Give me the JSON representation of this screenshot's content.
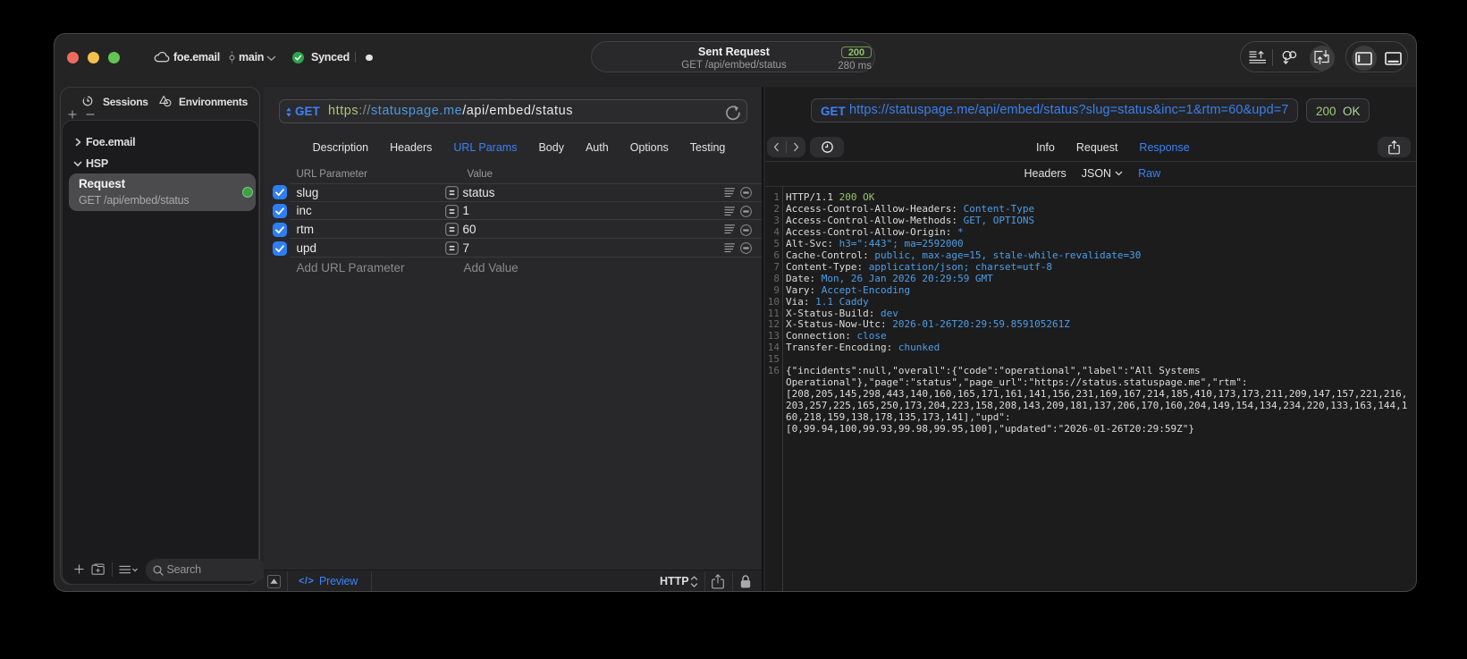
{
  "titlebar": {
    "project": "foe.email",
    "branch": "main",
    "sync_status": "Synced",
    "request_summary": {
      "title": "Sent Request",
      "subtitle": "GET /api/embed/status",
      "status_code": "200",
      "duration": "280 ms"
    }
  },
  "sidebar": {
    "tabs": [
      {
        "label": "Sessions",
        "icon": "history-clock-icon"
      },
      {
        "label": "Environments",
        "icon": "shapes-icon"
      }
    ],
    "tree": {
      "group_collapsed": "Foe.email",
      "group_expanded": "HSP",
      "selected_request": {
        "title": "Request",
        "subtitle": "GET /api/embed/status"
      }
    },
    "search_placeholder": "Search"
  },
  "request_editor": {
    "method": "GET",
    "url": {
      "scheme": "https",
      "sep": "://",
      "host": "statuspage.me",
      "path": "/api/embed/status"
    },
    "tabs": [
      "Description",
      "Headers",
      "URL Params",
      "Body",
      "Auth",
      "Options",
      "Testing"
    ],
    "active_tab": "URL Params",
    "params": {
      "col_name": "URL Parameter",
      "col_value": "Value",
      "rows": [
        {
          "name": "slug",
          "value": "status"
        },
        {
          "name": "inc",
          "value": "1"
        },
        {
          "name": "rtm",
          "value": "60"
        },
        {
          "name": "upd",
          "value": "7"
        }
      ],
      "add_name": "Add URL Parameter",
      "add_value": "Add Value"
    },
    "footer": {
      "code_glyph": "</>",
      "preview": "Preview",
      "protocol": "HTTP"
    }
  },
  "response_viewer": {
    "method": "GET",
    "url": "https://statuspage.me/api/embed/status?slug=status&inc=1&rtm=60&upd=7",
    "status_code": "200",
    "status_text": "OK",
    "tabs": [
      "Info",
      "Request",
      "Response"
    ],
    "active_tab": "Response",
    "subtabs": [
      "Headers",
      "JSON",
      "Raw"
    ],
    "active_subtab": "Raw",
    "lines": [
      {
        "n": "1",
        "parts": [
          {
            "t": "HTTP/1.1 ",
            "c": "rw"
          },
          {
            "t": "200 OK",
            "c": "rg"
          }
        ]
      },
      {
        "n": "2",
        "parts": [
          {
            "t": "Access-Control-Allow-Headers:",
            "c": "rn"
          },
          {
            "t": " Content-Type",
            "c": "rv"
          }
        ]
      },
      {
        "n": "3",
        "parts": [
          {
            "t": "Access-Control-Allow-Methods:",
            "c": "rn"
          },
          {
            "t": " GET, OPTIONS",
            "c": "rv"
          }
        ]
      },
      {
        "n": "4",
        "parts": [
          {
            "t": "Access-Control-Allow-Origin:",
            "c": "rn"
          },
          {
            "t": " *",
            "c": "rv"
          }
        ]
      },
      {
        "n": "5",
        "parts": [
          {
            "t": "Alt-Svc:",
            "c": "rn"
          },
          {
            "t": " h3=\":443\"; ma=2592000",
            "c": "rv"
          }
        ]
      },
      {
        "n": "6",
        "parts": [
          {
            "t": "Cache-Control:",
            "c": "rn"
          },
          {
            "t": " public, max-age=15, stale-while-revalidate=30",
            "c": "rv"
          }
        ]
      },
      {
        "n": "7",
        "parts": [
          {
            "t": "Content-Type:",
            "c": "rn"
          },
          {
            "t": " application/json; charset=utf-8",
            "c": "rv"
          }
        ]
      },
      {
        "n": "8",
        "parts": [
          {
            "t": "Date:",
            "c": "rn"
          },
          {
            "t": " Mon, 26 Jan 2026 20:29:59 GMT",
            "c": "rv"
          }
        ]
      },
      {
        "n": "9",
        "parts": [
          {
            "t": "Vary:",
            "c": "rn"
          },
          {
            "t": " Accept-Encoding",
            "c": "rv"
          }
        ]
      },
      {
        "n": "10",
        "parts": [
          {
            "t": "Via:",
            "c": "rn"
          },
          {
            "t": " 1.1 Caddy",
            "c": "rv"
          }
        ]
      },
      {
        "n": "11",
        "parts": [
          {
            "t": "X-Status-Build:",
            "c": "rn"
          },
          {
            "t": " dev",
            "c": "rv"
          }
        ]
      },
      {
        "n": "12",
        "parts": [
          {
            "t": "X-Status-Now-Utc:",
            "c": "rn"
          },
          {
            "t": " 2026-01-26T20:29:59.859105261Z",
            "c": "rv"
          }
        ]
      },
      {
        "n": "13",
        "parts": [
          {
            "t": "Connection:",
            "c": "rn"
          },
          {
            "t": " close",
            "c": "rv"
          }
        ]
      },
      {
        "n": "14",
        "parts": [
          {
            "t": "Transfer-Encoding:",
            "c": "rn"
          },
          {
            "t": " chunked",
            "c": "rv"
          }
        ]
      },
      {
        "n": "15",
        "parts": []
      },
      {
        "n": "16",
        "parts": [
          {
            "t": "{\"incidents\":null,\"overall\":{\"code\":\"operational\",\"label\":\"All Systems",
            "c": "rw"
          }
        ]
      },
      {
        "n": "",
        "parts": [
          {
            "t": "Operational\"},\"page\":\"status\",\"page_url\":\"https://status.statuspage.me\",\"rtm\":",
            "c": "rw"
          }
        ]
      },
      {
        "n": "",
        "parts": [
          {
            "t": "[208,205,145,298,443,140,160,165,171,161,141,156,231,169,167,214,185,410,173,173,211,209,147,157,221,216,",
            "c": "rw"
          }
        ]
      },
      {
        "n": "",
        "parts": [
          {
            "t": "203,257,225,165,250,173,204,223,158,208,143,209,181,137,206,170,160,204,149,154,134,234,220,133,163,144,1",
            "c": "rw"
          }
        ]
      },
      {
        "n": "",
        "parts": [
          {
            "t": "60,218,159,138,178,135,173,141],\"upd\":",
            "c": "rw"
          }
        ]
      },
      {
        "n": "",
        "parts": [
          {
            "t": "[0,99.94,100,99.93,99.98,99.95,100],\"updated\":\"2026-01-26T20:29:59Z\"}",
            "c": "rw"
          }
        ]
      }
    ]
  }
}
